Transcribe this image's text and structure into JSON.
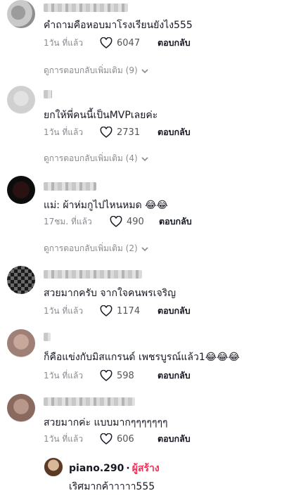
{
  "comments": [
    {
      "text": "คำถามคือหอบมาโรงเรียนยังไง555",
      "time": "1วัน ที่แล้ว",
      "likes": "6047",
      "reply_label": "ตอบกลับ",
      "view_more": "ดูการตอบกลับเพิ่มเติม (9)"
    },
    {
      "text": "ยกให้พี่คนนี้เป็นMVPเลยค่ะ",
      "time": "1วัน ที่แล้ว",
      "likes": "2731",
      "reply_label": "ตอบกลับ",
      "view_more": "ดูการตอบกลับเพิ่มเติม (4)"
    },
    {
      "text": "แม่: ผ้าห่มกูไปไหนหมด 😂😂",
      "time": "17ชม. ที่แล้ว",
      "likes": "490",
      "reply_label": "ตอบกลับ",
      "view_more": "ดูการตอบกลับเพิ่มเติม (2)"
    },
    {
      "text": "สวยมากครับ จากใจคนพรเจริญ",
      "time": "1วัน ที่แล้ว",
      "likes": "1174",
      "reply_label": "ตอบกลับ"
    },
    {
      "text": "ก็คือแข่งกับมิสแกรนด์ เพชรบูรณ์แล้ว1😂😂😂",
      "time": "1วัน ที่แล้ว",
      "likes": "598",
      "reply_label": "ตอบกลับ"
    },
    {
      "text": "สวยมากค่ะ แบบมากๆๆๆๆๆๆๆ",
      "time": "1วัน ที่แล้ว",
      "likes": "606",
      "reply_label": "ตอบกลับ"
    }
  ],
  "creator_reply": {
    "username": "piano.290",
    "separator": "·",
    "badge": "ผู้สร้าง",
    "text": "เริศมากค้าาาาา555"
  },
  "colors": {
    "accent": "#fe2c55",
    "muted": "#8a8b91"
  },
  "icons": [
    "heart-icon",
    "chevron-down-icon"
  ]
}
